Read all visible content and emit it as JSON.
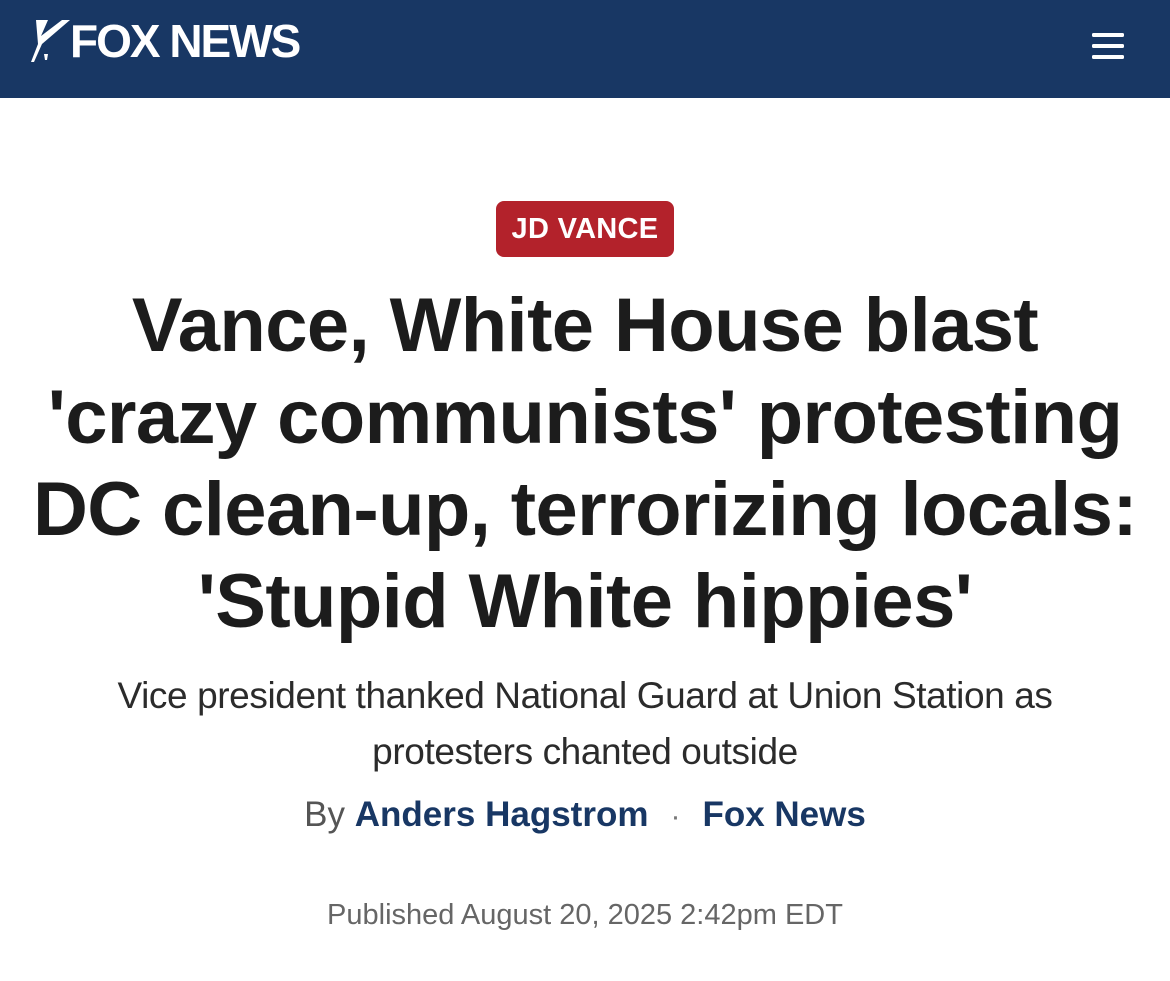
{
  "header": {
    "logo_text": "FOX NEWS",
    "background_color": "#183764",
    "menu_icon": "hamburger-menu-icon"
  },
  "article": {
    "category": "JD VANCE",
    "category_color": "#b3222b",
    "headline": "Vance, White House blast 'crazy communists' protesting DC clean-up, terrorizing locals: 'Stupid White hippies'",
    "subheadline": "Vice president thanked National Guard at Union Station as protesters chanted outside",
    "byline": {
      "prefix": "By",
      "author": "Anders Hagstrom",
      "separator": "·",
      "source": "Fox News"
    },
    "published": "Published August 20, 2025 2:42pm EDT"
  }
}
